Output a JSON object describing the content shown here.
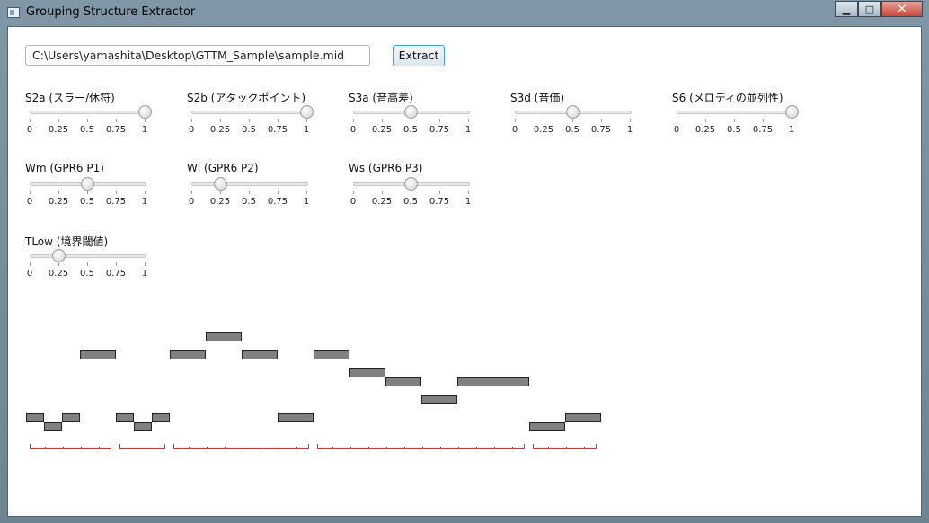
{
  "window": {
    "title": "Grouping Structure Extractor",
    "minimize_label": "▁",
    "maximize_label": "□",
    "close_label": "✕"
  },
  "file": {
    "path": "C:\\Users\\yamashita\\Desktop\\GTTM_Sample\\sample.mid"
  },
  "extract_label": "Extract",
  "tick_labels": [
    "0",
    "0.25",
    "0.5",
    "0.75",
    "1"
  ],
  "sliders": [
    {
      "id": "s2a",
      "label": "S2a (スラー/休符)",
      "value": 1.0
    },
    {
      "id": "s2b",
      "label": "S2b (アタックポイント)",
      "value": 1.0
    },
    {
      "id": "s3a",
      "label": "S3a (音高差)",
      "value": 0.5
    },
    {
      "id": "s3d",
      "label": "S3d (音価)",
      "value": 0.5
    },
    {
      "id": "s6",
      "label": "S6 (メロディの並列性)",
      "value": 1.0
    },
    {
      "id": "wm",
      "label": "Wm (GPR6 P1)",
      "value": 0.5
    },
    {
      "id": "wl",
      "label": "Wl (GPR6 P2)",
      "value": 0.25
    },
    {
      "id": "ws",
      "label": "Ws (GPR6 P3)",
      "value": 0.5
    },
    {
      "id": "tlow",
      "label": "TLow (境界閾値)",
      "value": 0.25
    }
  ],
  "piano_roll": {
    "notes": [
      {
        "start": 0,
        "dur": 1,
        "pitch": 0
      },
      {
        "start": 1,
        "dur": 1,
        "pitch": -1
      },
      {
        "start": 2,
        "dur": 1,
        "pitch": 0
      },
      {
        "start": 3,
        "dur": 2,
        "pitch": 7
      },
      {
        "start": 5,
        "dur": 1,
        "pitch": 0
      },
      {
        "start": 6,
        "dur": 1,
        "pitch": -1
      },
      {
        "start": 7,
        "dur": 1,
        "pitch": 0
      },
      {
        "start": 8,
        "dur": 2,
        "pitch": 7
      },
      {
        "start": 10,
        "dur": 2,
        "pitch": 9
      },
      {
        "start": 12,
        "dur": 2,
        "pitch": 7
      },
      {
        "start": 14,
        "dur": 2,
        "pitch": 0
      },
      {
        "start": 16,
        "dur": 2,
        "pitch": 7
      },
      {
        "start": 18,
        "dur": 2,
        "pitch": 5
      },
      {
        "start": 20,
        "dur": 2,
        "pitch": 4
      },
      {
        "start": 22,
        "dur": 2,
        "pitch": 2
      },
      {
        "start": 24,
        "dur": 4,
        "pitch": 4
      },
      {
        "start": 28,
        "dur": 2,
        "pitch": -1
      },
      {
        "start": 30,
        "dur": 2,
        "pitch": 0
      }
    ],
    "groups": [
      {
        "start": 0,
        "end": 5
      },
      {
        "start": 5,
        "end": 8
      },
      {
        "start": 8,
        "end": 16
      },
      {
        "start": 16,
        "end": 28
      },
      {
        "start": 28,
        "end": 32
      }
    ]
  }
}
